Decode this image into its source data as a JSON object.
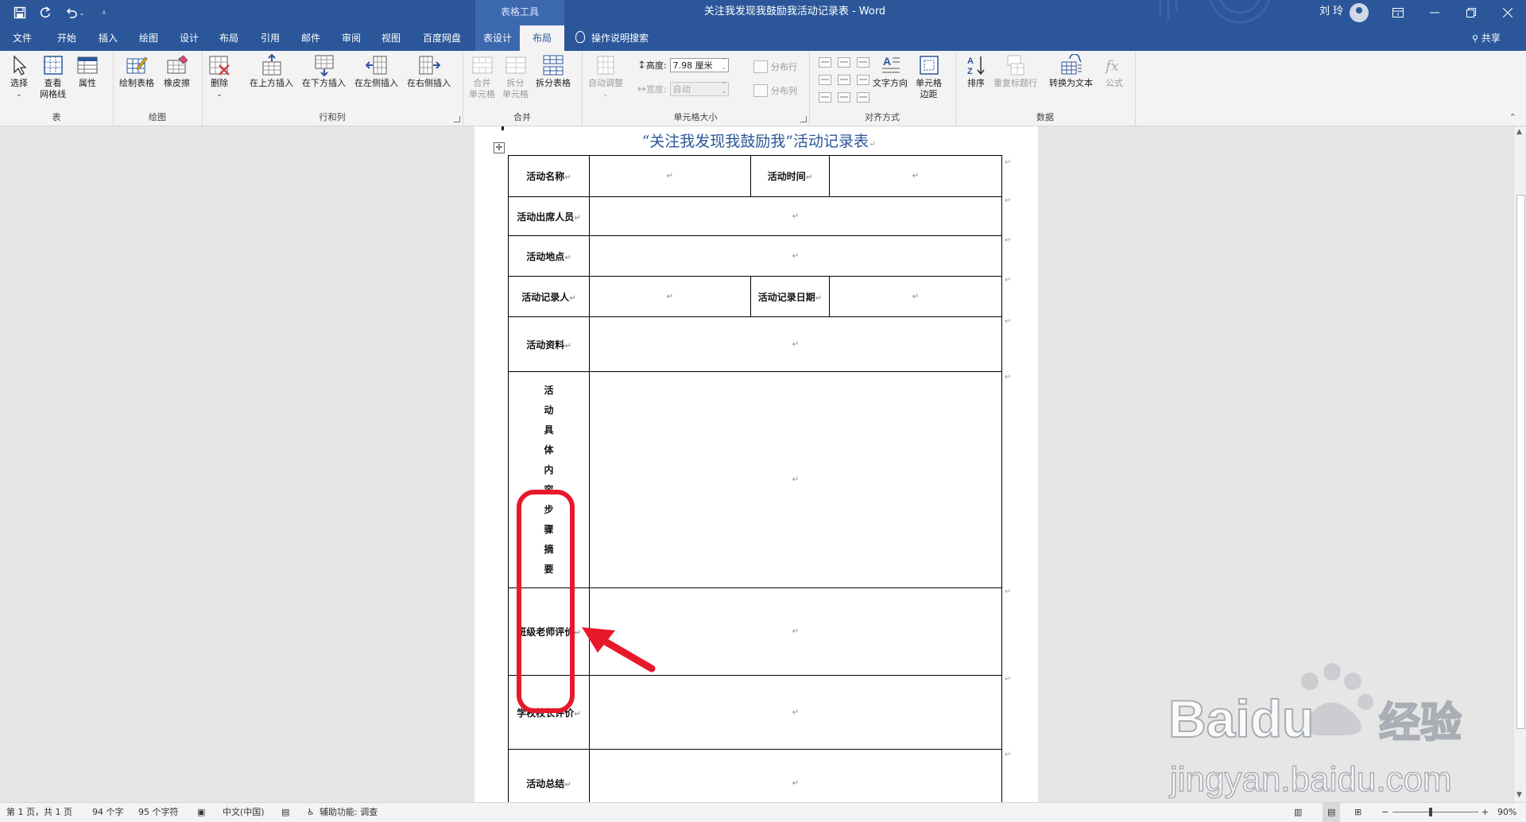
{
  "window": {
    "context_group": "表格工具",
    "title": "关注我发现我鼓励我活动记录表 - Word",
    "user": "刘 玲",
    "share": "共享"
  },
  "tabs": [
    "文件",
    "开始",
    "插入",
    "绘图",
    "设计",
    "布局",
    "引用",
    "邮件",
    "审阅",
    "视图",
    "百度网盘",
    "表设计",
    "布局"
  ],
  "tell_me": "操作说明搜索",
  "ribbon": {
    "groups": {
      "table": "表",
      "draw": "绘图",
      "rows_cols": "行和列",
      "merge": "合并",
      "cell_size": "单元格大小",
      "alignment": "对齐方式",
      "data": "数据"
    },
    "buttons": {
      "select": "选择",
      "view_gridlines": "查看\n网格线",
      "properties": "属性",
      "draw_table": "绘制表格",
      "eraser": "橡皮擦",
      "delete": "删除",
      "insert_above": "在上方插入",
      "insert_below": "在下方插入",
      "insert_left": "在左侧插入",
      "insert_right": "在右侧插入",
      "merge_cells": "合并\n单元格",
      "split_cells": "拆分\n单元格",
      "split_table": "拆分表格",
      "autofit": "自动调整",
      "text_direction": "文字方向",
      "cell_margins": "单元格\n边距",
      "sort": "排序",
      "repeat_header": "重复标题行",
      "convert_to_text": "转换为文本",
      "formula": "公式"
    },
    "height_label": "高度:",
    "height_value": "7.98 厘米",
    "width_label": "宽度:",
    "width_value": "自动",
    "distribute_rows": "分布行",
    "distribute_cols": "分布列"
  },
  "document": {
    "heading": "“关注我发现我鼓励我”活动记录表",
    "rows": [
      {
        "label": "活动名称",
        "label2": "活动时间"
      },
      {
        "label": "活动出席人员"
      },
      {
        "label": "活动地点"
      },
      {
        "label": "活动记录人",
        "label2": "活动记录日期"
      },
      {
        "label": "活动资料"
      },
      {
        "label_vertical": [
          "活",
          "动",
          "具",
          "体",
          "内",
          "容",
          "步",
          "骤",
          "摘",
          "要"
        ]
      },
      {
        "label": "班级老师评价"
      },
      {
        "label": "学校校长评价"
      },
      {
        "label": "活动总结"
      }
    ],
    "cell_mark": "↵"
  },
  "watermark": {
    "brand": "Baidu",
    "brand_cn": "经验",
    "url": "jingyan.baidu.com"
  },
  "status": {
    "page": "第 1 页，共 1 页",
    "words": "94 个字",
    "chars": "95 个字符",
    "language": "中文(中国)",
    "accessibility": "辅助功能: 调查",
    "zoom": "90%"
  },
  "colors": {
    "brand": "#2b579a",
    "highlight": "#e8182b"
  }
}
